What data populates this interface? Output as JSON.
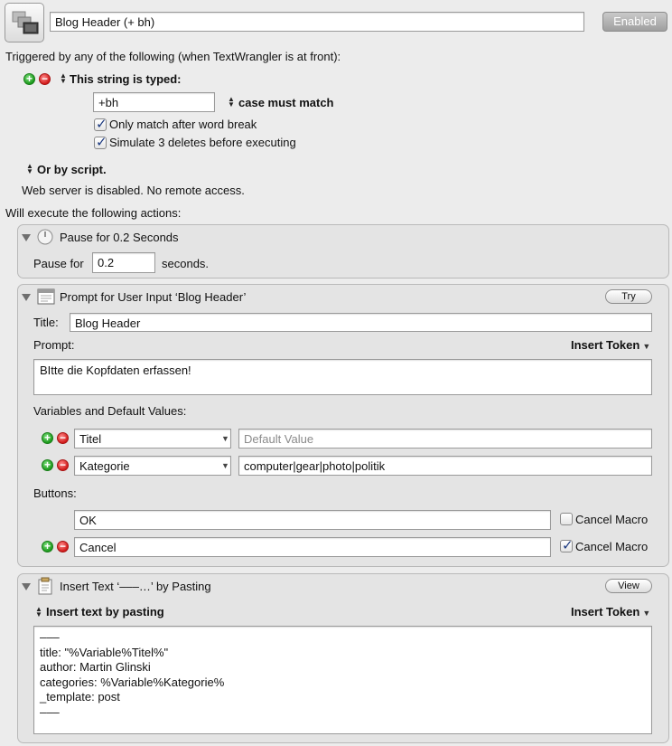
{
  "header": {
    "macro_name": "Blog Header (+ bh)",
    "enabled_label": "Enabled"
  },
  "triggers": {
    "intro": "Triggered by any of the following (when TextWrangler is at front):",
    "string_trigger": {
      "label": "This string is typed:",
      "value": "+bh",
      "case_option": "case must match",
      "option1_label": "Only match after word break",
      "option1_checked": true,
      "option2_label": "Simulate 3 deletes before executing",
      "option2_checked": true
    },
    "script_trigger_label": "Or by script.",
    "web_server_status": "Web server is disabled.  No remote access."
  },
  "actions_intro": "Will execute the following actions:",
  "actions": {
    "pause": {
      "title": "Pause for 0.2 Seconds",
      "pause_label": "Pause for",
      "value": "0.2",
      "unit": "seconds."
    },
    "prompt": {
      "title": "Prompt for User Input ‘Blog Header’",
      "try_label": "Try",
      "title_label": "Title:",
      "title_value": "Blog Header",
      "prompt_label": "Prompt:",
      "insert_token_label": "Insert Token",
      "prompt_text": "BItte die Kopfdaten erfassen!",
      "variables_label": "Variables and Default Values:",
      "variables": [
        {
          "name": "Titel",
          "default_value": "",
          "default_placeholder": "Default Value"
        },
        {
          "name": "Kategorie",
          "default_value": "computer|gear|photo|politik",
          "default_placeholder": ""
        }
      ],
      "buttons_label": "Buttons:",
      "buttons": [
        {
          "name": "OK",
          "cancel_label": "Cancel Macro",
          "cancel_checked": false
        },
        {
          "name": "Cancel",
          "cancel_label": "Cancel Macro",
          "cancel_checked": true
        }
      ]
    },
    "insert_text": {
      "title": "Insert Text ‘–––…’ by Pasting",
      "view_label": "View",
      "mode_label": "Insert text by pasting",
      "insert_token_label": "Insert Token",
      "text": "–––\ntitle: \"%Variable%Titel%\"\nauthor: Martin Glinski\ncategories: %Variable%Kategorie%\n_template: post\n–––"
    }
  },
  "icons": {
    "macro_icon": "macro-group-icon",
    "pause_icon": "clock-icon",
    "prompt_icon": "window-icon",
    "insert_text_icon": "clipboard-icon"
  }
}
